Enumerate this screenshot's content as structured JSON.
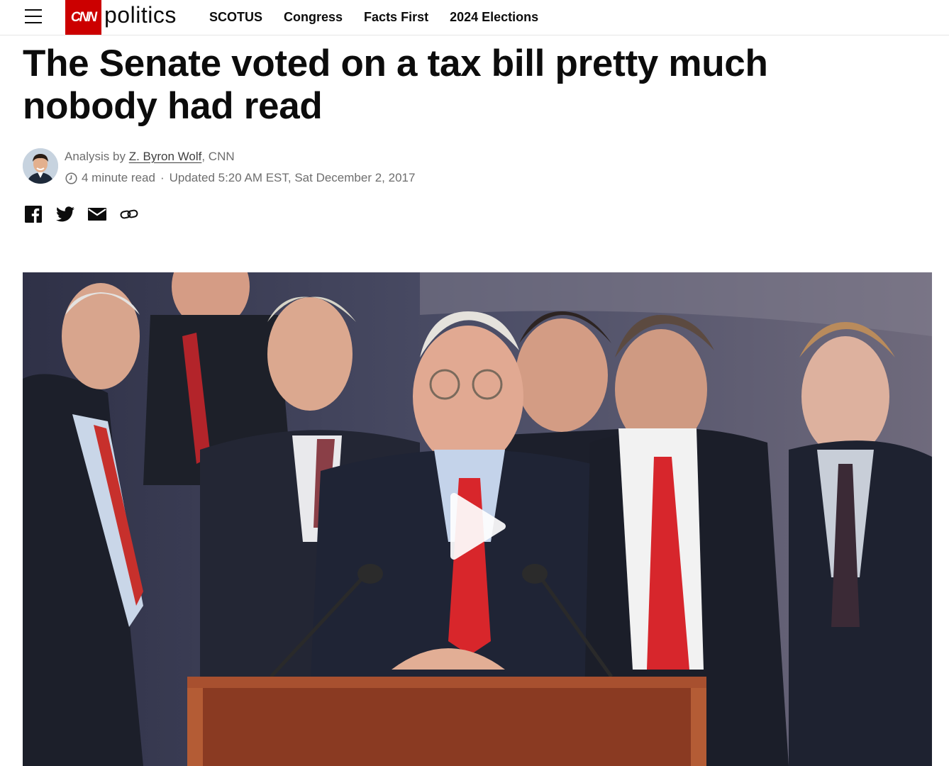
{
  "header": {
    "logo_text": "CNN",
    "section": "politics",
    "nav": [
      "SCOTUS",
      "Congress",
      "Facts First",
      "2024 Elections"
    ]
  },
  "article": {
    "headline": "The Senate voted on a tax bill pretty much nobody had read",
    "byline_prefix": "Analysis by ",
    "author": "Z. Byron Wolf",
    "byline_suffix": ", CNN",
    "read_time": "4 minute read",
    "separator": "·",
    "updated": "Updated 5:20 AM EST, Sat December 2, 2017"
  },
  "share": [
    "facebook-icon",
    "twitter-icon",
    "email-icon",
    "link-icon"
  ],
  "colors": {
    "brand": "#cc0000",
    "text": "#0c0c0c",
    "meta": "#6e6e6e"
  }
}
